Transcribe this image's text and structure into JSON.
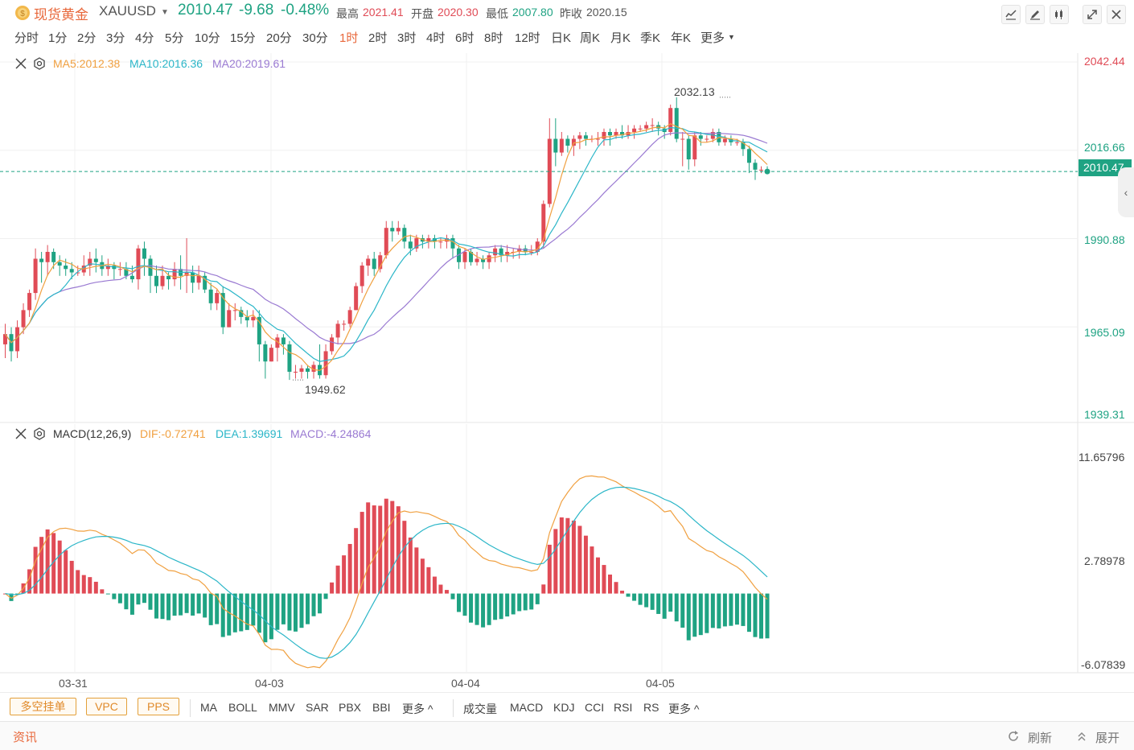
{
  "header": {
    "title": "现货黄金",
    "symbol": "XAUUSD",
    "price": "2010.47",
    "change": "-9.68",
    "change_pct": "-0.48%",
    "high_label": "最高",
    "high": "2021.41",
    "open_label": "开盘",
    "open": "2020.30",
    "low_label": "最低",
    "low": "2007.80",
    "prev_label": "昨收",
    "prev": "2020.15"
  },
  "tools": [
    "line-chart-icon",
    "pencil-icon",
    "candlestick-icon",
    "expand-icon",
    "close-icon"
  ],
  "periods": [
    "分时",
    "1分",
    "2分",
    "3分",
    "4分",
    "5分",
    "10分",
    "15分",
    "20分",
    "30分",
    "1时",
    "2时",
    "3时",
    "4时",
    "6时",
    "8时",
    "12时",
    "日K",
    "周K",
    "月K",
    "季K",
    "年K",
    "更多"
  ],
  "active_period": "1时",
  "main_chart": {
    "legend": {
      "ma5": "MA5:2012.38",
      "ma10": "MA10:2016.36",
      "ma20": "MA20:2019.61"
    },
    "y_ticks": [
      "2042.44",
      "2016.66",
      "1990.88",
      "1965.09",
      "1939.31"
    ],
    "current_price": "2010.47",
    "high_annotation": "2032.13",
    "low_annotation": "1949.62"
  },
  "macd_chart": {
    "legend": {
      "name": "MACD(12,26,9)",
      "dif": "DIF:-0.72741",
      "dea": "DEA:1.39691",
      "macd": "MACD:-4.24864"
    },
    "y_ticks": [
      "11.65796",
      "2.78978",
      "-6.07839"
    ]
  },
  "x_ticks": [
    "03-31",
    "04-03",
    "04-04",
    "04-05"
  ],
  "bottom": {
    "buttons": [
      "多空挂单",
      "VPC",
      "PPS"
    ],
    "main_indicators": [
      "MA",
      "BOLL",
      "MMV",
      "SAR",
      "PBX",
      "BBI",
      "更多 ^"
    ],
    "sub_indicators": [
      "成交量",
      "MACD",
      "KDJ",
      "CCI",
      "RSI",
      "RS",
      "更多 ^"
    ]
  },
  "footer": {
    "news": "资讯",
    "refresh": "刷新",
    "expand": "展开"
  },
  "colors": {
    "up": "#e04b56",
    "down": "#1fa383",
    "ma5": "#f0a040",
    "ma10": "#2bb6c8",
    "ma20": "#9a7ad2",
    "accent": "#e8673a"
  },
  "chart_data": {
    "type": "candlestick",
    "x_ticks": [
      "03-31",
      "04-03",
      "04-04",
      "04-05"
    ],
    "ylim": [
      1939.31,
      2042.44
    ],
    "candles": [
      [
        1960,
        1963,
        1956,
        1966
      ],
      [
        1963,
        1958,
        1955,
        1965
      ],
      [
        1958,
        1965,
        1956,
        1967
      ],
      [
        1965,
        1970,
        1963,
        1972
      ],
      [
        1970,
        1975,
        1968,
        1976
      ],
      [
        1975,
        1985,
        1973,
        1988
      ],
      [
        1985,
        1984,
        1978,
        1987
      ],
      [
        1984,
        1987,
        1980,
        1989
      ],
      [
        1987,
        1984,
        1982,
        1988
      ],
      [
        1984,
        1983,
        1980,
        1986
      ],
      [
        1983,
        1982,
        1980,
        1985
      ],
      [
        1982,
        1981,
        1979,
        1984
      ],
      [
        1981,
        1981,
        1980,
        1983
      ],
      [
        1981,
        1983,
        1980,
        1986
      ],
      [
        1983,
        1985,
        1980,
        1987
      ],
      [
        1985,
        1984,
        1981,
        1988
      ],
      [
        1984,
        1982,
        1980,
        1986
      ],
      [
        1982,
        1983,
        1980,
        1985
      ],
      [
        1983,
        1982,
        1979,
        1984
      ],
      [
        1982,
        1982,
        1980,
        1984
      ],
      [
        1982,
        1980,
        1979,
        1984
      ],
      [
        1980,
        1979,
        1978,
        1983
      ],
      [
        1979,
        1988,
        1976,
        1989
      ],
      [
        1988,
        1985,
        1980,
        1990
      ],
      [
        1985,
        1980,
        1975,
        1986
      ],
      [
        1980,
        1977,
        1975,
        1983
      ],
      [
        1977,
        1980,
        1976,
        1983
      ],
      [
        1980,
        1979,
        1976,
        1981
      ],
      [
        1979,
        1982,
        1977,
        1984
      ],
      [
        1982,
        1980,
        1976,
        1986
      ],
      [
        1980,
        1981,
        1975,
        1991
      ],
      [
        1981,
        1978,
        1975,
        1983
      ],
      [
        1978,
        1980,
        1976,
        1983
      ],
      [
        1980,
        1976,
        1975,
        1981
      ],
      [
        1976,
        1972,
        1970,
        1978
      ],
      [
        1972,
        1975,
        1970,
        1976
      ],
      [
        1975,
        1965,
        1963,
        1977
      ],
      [
        1965,
        1970,
        1965,
        1972
      ],
      [
        1970,
        1970,
        1967,
        1972
      ],
      [
        1970,
        1968,
        1966,
        1971
      ],
      [
        1968,
        1967,
        1965,
        1970
      ],
      [
        1967,
        1968,
        1965,
        1970
      ],
      [
        1968,
        1960,
        1955,
        1970
      ],
      [
        1960,
        1955,
        1950,
        1961
      ],
      [
        1955,
        1959,
        1955,
        1960
      ],
      [
        1959,
        1962,
        1955,
        1963
      ],
      [
        1962,
        1960,
        1957,
        1963
      ],
      [
        1960,
        1952,
        1949.62,
        1961
      ],
      [
        1952,
        1952,
        1950,
        1954
      ],
      [
        1952,
        1953,
        1950,
        1954
      ],
      [
        1953,
        1952,
        1950,
        1954
      ],
      [
        1952,
        1954,
        1950,
        1955
      ],
      [
        1954,
        1951,
        1950,
        1960
      ],
      [
        1951,
        1958,
        1950,
        1960
      ],
      [
        1958,
        1962,
        1957,
        1963
      ],
      [
        1962,
        1966,
        1960,
        1967
      ],
      [
        1966,
        1966,
        1964,
        1967
      ],
      [
        1966,
        1970,
        1965,
        1971
      ],
      [
        1970,
        1977,
        1970,
        1978
      ],
      [
        1977,
        1983,
        1975,
        1984
      ],
      [
        1983,
        1985,
        1980,
        1986
      ],
      [
        1985,
        1982,
        1980,
        1987
      ],
      [
        1982,
        1986,
        1981,
        1987
      ],
      [
        1986,
        1994,
        1985,
        1996
      ],
      [
        1994,
        1993,
        1990,
        1996
      ],
      [
        1993,
        1994,
        1992,
        1996
      ],
      [
        1994,
        1990,
        1988,
        1995
      ],
      [
        1990,
        1988,
        1986,
        1992
      ],
      [
        1988,
        1991,
        1987,
        1992
      ],
      [
        1991,
        1990,
        1988,
        1992
      ],
      [
        1990,
        1991,
        1988,
        1992
      ],
      [
        1991,
        1990,
        1988,
        1992
      ],
      [
        1990,
        1990,
        1988,
        1991
      ],
      [
        1990,
        1991,
        1988,
        1992
      ],
      [
        1991,
        1988,
        1985,
        1992
      ],
      [
        1988,
        1984,
        1982,
        1989
      ],
      [
        1984,
        1987,
        1982,
        1988
      ],
      [
        1987,
        1984,
        1983,
        1988
      ],
      [
        1984,
        1985,
        1983,
        1987
      ],
      [
        1985,
        1984,
        1982,
        1986
      ],
      [
        1984,
        1986,
        1982,
        1987
      ],
      [
        1986,
        1988,
        1984,
        1989
      ],
      [
        1988,
        1986,
        1984,
        1989
      ],
      [
        1986,
        1987,
        1984,
        1989
      ],
      [
        1987,
        1987,
        1985,
        1988
      ],
      [
        1987,
        1988,
        1985,
        1989
      ],
      [
        1988,
        1987,
        1986,
        1989
      ],
      [
        1987,
        1987,
        1986,
        1989
      ],
      [
        1987,
        1990,
        1986,
        1991
      ],
      [
        1990,
        2001,
        1988,
        2002
      ],
      [
        2001,
        2020,
        2000,
        2026
      ],
      [
        2020,
        2016,
        2012,
        2026
      ],
      [
        2016,
        2020,
        2015,
        2022
      ],
      [
        2020,
        2018,
        2016,
        2021
      ],
      [
        2018,
        2020,
        2015,
        2021
      ],
      [
        2020,
        2021,
        2017,
        2022
      ],
      [
        2021,
        2020,
        2018,
        2022
      ],
      [
        2020,
        2020,
        2019,
        2021
      ],
      [
        2020,
        2020,
        2018,
        2022
      ],
      [
        2020,
        2022,
        2018,
        2023
      ],
      [
        2022,
        2021,
        2018,
        2023
      ],
      [
        2021,
        2022,
        2020,
        2023
      ],
      [
        2022,
        2021,
        2020,
        2024
      ],
      [
        2021,
        2022,
        2020,
        2024
      ],
      [
        2022,
        2023,
        2020,
        2024
      ],
      [
        2023,
        2023,
        2022,
        2024
      ],
      [
        2023,
        2024,
        2022,
        2025
      ],
      [
        2024,
        2024,
        2022,
        2026
      ],
      [
        2024,
        2023,
        2021,
        2025
      ],
      [
        2023,
        2022,
        2020,
        2024
      ],
      [
        2022,
        2029,
        2021,
        2030
      ],
      [
        2029,
        2020,
        2019,
        2032.13
      ],
      [
        2020,
        2020,
        2012,
        2022
      ],
      [
        2020,
        2014,
        2011,
        2021
      ],
      [
        2014,
        2021,
        2012,
        2022
      ],
      [
        2021,
        2020,
        2018,
        2022
      ],
      [
        2020,
        2020,
        2019,
        2021
      ],
      [
        2020,
        2022,
        2019,
        2023
      ],
      [
        2022,
        2019,
        2018,
        2023
      ],
      [
        2019,
        2020,
        2018,
        2021
      ],
      [
        2020,
        2019,
        2018,
        2021
      ],
      [
        2019,
        2019,
        2018,
        2020
      ],
      [
        2019,
        2017,
        2015,
        2020
      ],
      [
        2017,
        2013,
        2010,
        2018
      ],
      [
        2013,
        2011,
        2008,
        2014
      ],
      [
        2011,
        2011,
        2010,
        2012
      ],
      [
        2011,
        2010.47,
        2010,
        2012
      ]
    ]
  }
}
